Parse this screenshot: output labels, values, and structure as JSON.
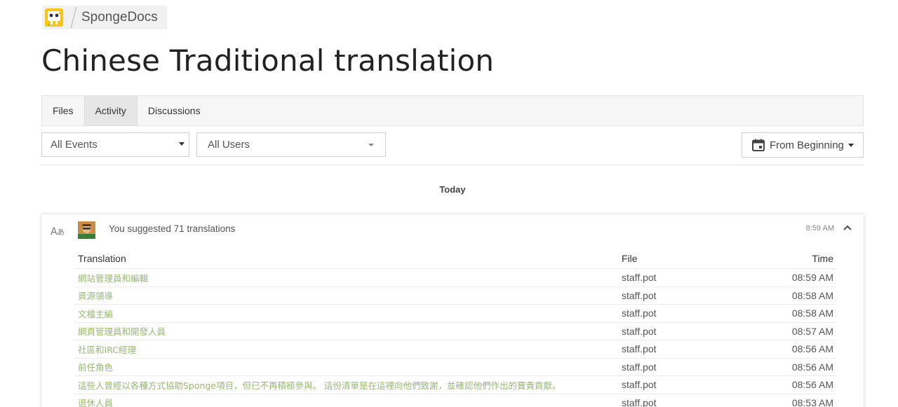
{
  "breadcrumb": {
    "project": "SpongeDocs"
  },
  "page": {
    "title": "Chinese Traditional translation"
  },
  "tabs": [
    {
      "label": "Files",
      "active": false
    },
    {
      "label": "Activity",
      "active": true
    },
    {
      "label": "Discussions",
      "active": false
    }
  ],
  "filters": {
    "events": "All Events",
    "users": "All Users",
    "date": "From Beginning"
  },
  "day_label": "Today",
  "event": {
    "icon": "translate-icon",
    "description": "You suggested 71 translations",
    "time": "8:59 AM",
    "columns": {
      "translation": "Translation",
      "file": "File",
      "time": "Time"
    },
    "rows": [
      {
        "translation": "網站管理員和編輯",
        "file": "staff.pot",
        "time": "08:59 AM"
      },
      {
        "translation": "資源領導",
        "file": "staff.pot",
        "time": "08:58 AM"
      },
      {
        "translation": "文檔主編",
        "file": "staff.pot",
        "time": "08:58 AM"
      },
      {
        "translation": "網頁管理員和開發人員",
        "file": "staff.pot",
        "time": "08:57 AM"
      },
      {
        "translation": "社區和IRC經理",
        "file": "staff.pot",
        "time": "08:56 AM"
      },
      {
        "translation": "前任角色",
        "file": "staff.pot",
        "time": "08:56 AM"
      },
      {
        "translation": "這些人曾經以各種方式協助Sponge項目，但已不再積極參與。 這份清單是在這裡向他們致謝，並確認他們作出的寶貴貢獻。",
        "file": "staff.pot",
        "time": "08:56 AM"
      },
      {
        "translation": "退休人員",
        "file": "staff.pot",
        "time": "08:53 AM"
      }
    ]
  },
  "colors": {
    "translation_link": "#9ab774",
    "accent_logo": "#f5c518"
  }
}
